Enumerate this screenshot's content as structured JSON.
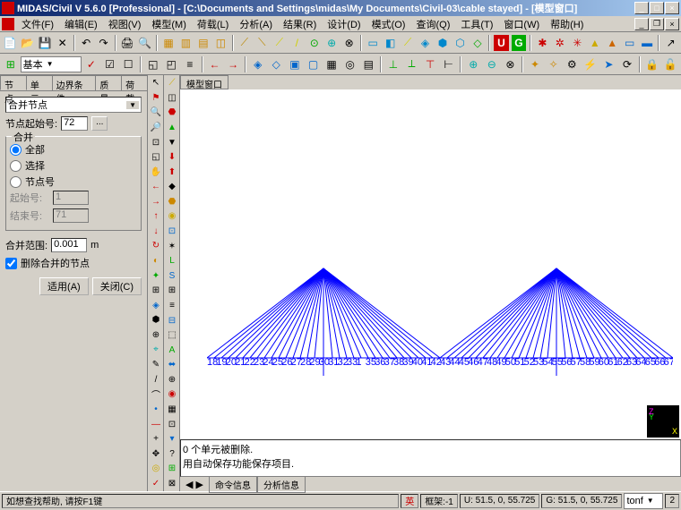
{
  "title": "MIDAS/Civil V 5.6.0 [Professional] - [C:\\Documents and Settings\\midas\\My Documents\\Civil-03\\cable stayed] - [模型窗口]",
  "menu": [
    "文件(F)",
    "编辑(E)",
    "视图(V)",
    "模型(M)",
    "荷载(L)",
    "分析(A)",
    "结果(R)",
    "设计(D)",
    "模式(O)",
    "查询(Q)",
    "工具(T)",
    "窗口(W)",
    "帮助(H)"
  ],
  "tb2_combo": "基本",
  "panel_tabs": [
    "节点",
    "单元",
    "边界条件",
    "质量",
    "荷载"
  ],
  "combo_merge": "合并节点",
  "lbl_start": "节点起始号:",
  "start_val": "72",
  "group_merge": "合并",
  "radio_all": "全部",
  "radio_sel": "选择",
  "radio_node": "节点号",
  "lbl_from": "起始号:",
  "from_val": "1",
  "lbl_to": "结束号:",
  "to_val": "71",
  "lbl_tol": "合并范围:",
  "tol_val": "0.001",
  "tol_unit": "m",
  "chk_del": "删除合并的节点",
  "btn_apply": "适用(A)",
  "btn_close": "关闭(C)",
  "viewtab": "模型窗口",
  "msg1": "0 个单元被删除.",
  "msg2": "用自动保存功能保存项目.",
  "msgtab1": "命令信息",
  "msgtab2": "分析信息",
  "status_help": "如想查找帮助, 请按F1键",
  "status_frame": "框架:-1",
  "status_u": "U: 51.5, 0, 55.725",
  "status_g": "G: 51.5, 0, 55.725",
  "input_combo": "tonf",
  "input_page": "2",
  "ime": "英"
}
